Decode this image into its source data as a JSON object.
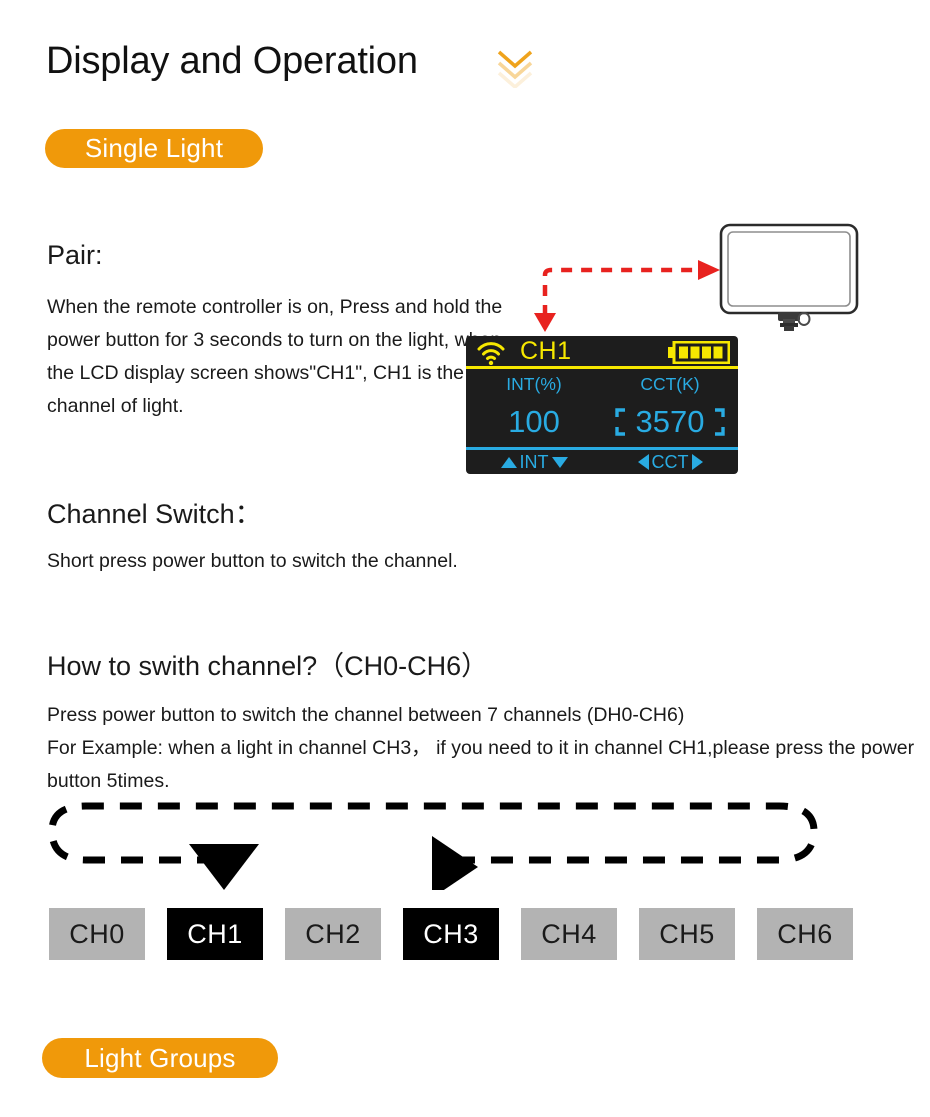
{
  "page": {
    "title": "Display and Operation",
    "chevron_icon": "double-chevron-down-icon"
  },
  "badges": {
    "single_light": "Single Light",
    "light_groups": "Light Groups"
  },
  "sections": {
    "pair": {
      "heading": "Pair:",
      "body": "When the remote controller is on, Press and hold the power button for 3 seconds to turn on the light, when the LCD display screen shows\"CH1\", CH1 is the channel of light."
    },
    "channel_switch": {
      "heading": "Channel Switch：",
      "body": "Short press power button to switch the channel."
    },
    "how_to_switch": {
      "heading": "How to swith channel?（CH0-CH6）",
      "body": "Press power button to switch the channel between 7 channels (DH0-CH6)\nFor Example: when a light in channel CH3，  if you need to it in channel CH1,please press the power button 5times."
    }
  },
  "lcd": {
    "wifi_icon": "wifi-signal-icon",
    "channel": "CH1",
    "battery_icon": "battery-full-icon",
    "battery_bars": 4,
    "int_label": "INT(%)",
    "cct_label": "CCT(K)",
    "int_value": "100",
    "cct_value": "3570",
    "nav_int_label": "INT",
    "nav_cct_label": "CCT",
    "colors": {
      "background": "#1d1d1d",
      "yellow": "#F7E800",
      "cyan": "#29ABE2"
    }
  },
  "illustration": {
    "led_panel": "led-light-panel-icon",
    "pair_arrow": "red-dashed-pairing-arrow"
  },
  "channel_diagram": {
    "loop_arrow": "dashed-loop-arrow",
    "channels": [
      {
        "label": "CH0",
        "active": false
      },
      {
        "label": "CH1",
        "active": true
      },
      {
        "label": "CH2",
        "active": false
      },
      {
        "label": "CH3",
        "active": true
      },
      {
        "label": "CH4",
        "active": false
      },
      {
        "label": "CH5",
        "active": false
      },
      {
        "label": "CH6",
        "active": false
      }
    ],
    "colors": {
      "inactive": "#B3B3B3",
      "active": "#000000"
    }
  },
  "theme": {
    "accent_orange": "#F0990A",
    "arrow_red": "#E8221F"
  }
}
